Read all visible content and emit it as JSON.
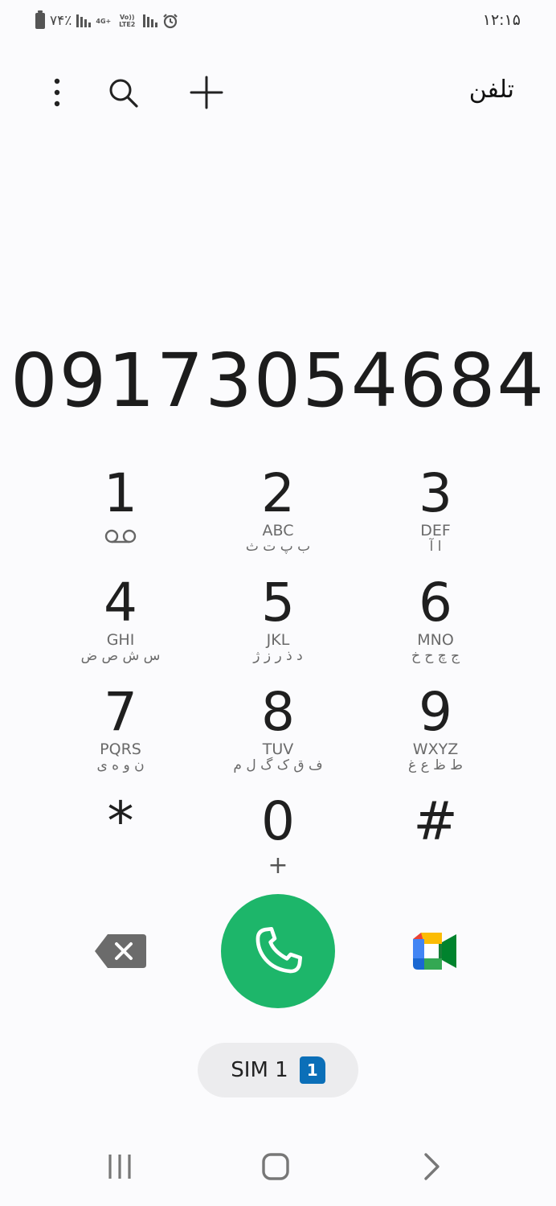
{
  "status_bar": {
    "battery_text": "٧۴٪",
    "network_1": "4G+",
    "network_2": "Vo)) LTE2",
    "time": "۱۲:۱۵"
  },
  "top_bar": {
    "title": "تلفن",
    "icons": [
      "more-options-icon",
      "search-icon",
      "add-contact-icon"
    ]
  },
  "dialer": {
    "number": "09173054684"
  },
  "keypad": [
    {
      "digit": "1",
      "letters": "",
      "fa": "",
      "icon": "voicemail-icon"
    },
    {
      "digit": "2",
      "letters": "ABC",
      "fa": "ب پ ت ث"
    },
    {
      "digit": "3",
      "letters": "DEF",
      "fa": "ا آ"
    },
    {
      "digit": "4",
      "letters": "GHI",
      "fa": "س ش ص ض"
    },
    {
      "digit": "5",
      "letters": "JKL",
      "fa": "د ذ ر ز ژ"
    },
    {
      "digit": "6",
      "letters": "MNO",
      "fa": "ج چ ح خ"
    },
    {
      "digit": "7",
      "letters": "PQRS",
      "fa": "ن و ه ی"
    },
    {
      "digit": "8",
      "letters": "TUV",
      "fa": "ف ق ک گ ل م"
    },
    {
      "digit": "9",
      "letters": "WXYZ",
      "fa": "ط ظ ع غ"
    },
    {
      "digit": "*",
      "letters": "",
      "fa": ""
    },
    {
      "digit": "0",
      "letters": "",
      "fa": "",
      "sub": "+"
    },
    {
      "digit": "#",
      "letters": "",
      "fa": ""
    }
  ],
  "actions": {
    "sim_label": "SIM 1",
    "sim_badge": "1",
    "call_color": "#1db66a",
    "sim_badge_color": "#0b6fb8"
  },
  "nav": [
    "recent-apps-icon",
    "home-icon",
    "back-icon"
  ]
}
